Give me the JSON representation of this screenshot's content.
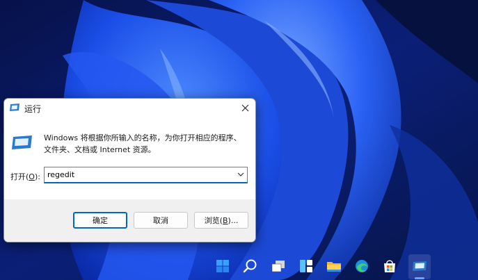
{
  "dialog": {
    "title": "运行",
    "description_line1": "Windows 将根据你所输入的名称，为你打开相应的程序、",
    "description_line2": "文件夹、文档或 Internet 资源。",
    "open_label_prefix": "打开(",
    "open_label_key": "O",
    "open_label_suffix": "):",
    "input_value": "regedit",
    "ok_label": "确定",
    "cancel_label": "取消",
    "browse_label_prefix": "浏览(",
    "browse_label_key": "B",
    "browse_label_suffix": ")..."
  },
  "taskbar": {
    "icons": [
      "start-icon",
      "search-icon",
      "task-view-icon",
      "widgets-icon",
      "file-explorer-icon",
      "edge-icon",
      "store-icon",
      "run-app-icon"
    ]
  },
  "colors": {
    "accent": "#0067c0",
    "wallpaper_dark": "#0b1a66",
    "wallpaper_bright": "#1f5cff"
  }
}
